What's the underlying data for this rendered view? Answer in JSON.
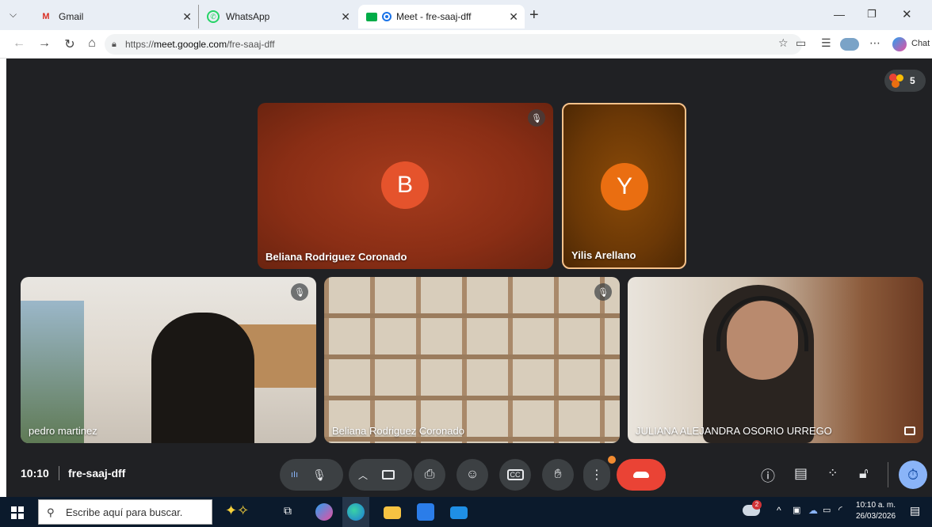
{
  "browser": {
    "tabs": [
      {
        "label": "Gmail"
      },
      {
        "label": "WhatsApp"
      },
      {
        "label": "Meet - fre-saaj-dff"
      }
    ],
    "url_prefix": "https://",
    "url_host": "meet.google.com",
    "url_path": "/fre-saaj-dff",
    "chat_label": "Chat"
  },
  "meet": {
    "participants_count": "5",
    "tiles": [
      {
        "name": "Beliana Rodriguez Coronado",
        "initial": "B",
        "color": "#e04e2a"
      },
      {
        "name": "Yilis Arellano",
        "initial": "Y",
        "color": "#ea6e11"
      },
      {
        "name": "pedro martinez"
      },
      {
        "name": "Beliana Rodriguez Coronado"
      },
      {
        "name": "JULIANA ALEJANDRA OSORIO URREGO"
      }
    ],
    "time": "10:10",
    "meeting_code": "fre-saaj-dff"
  },
  "taskbar": {
    "search_placeholder": "Escribe aquí para buscar.",
    "clock_time": "10:10 a. m.",
    "clock_date": "26/03/2026",
    "weather_badge": "2"
  },
  "colors": {
    "meet_bg": "#202124",
    "end_call": "#ea4335",
    "raise_highlight": "#f28b82"
  }
}
